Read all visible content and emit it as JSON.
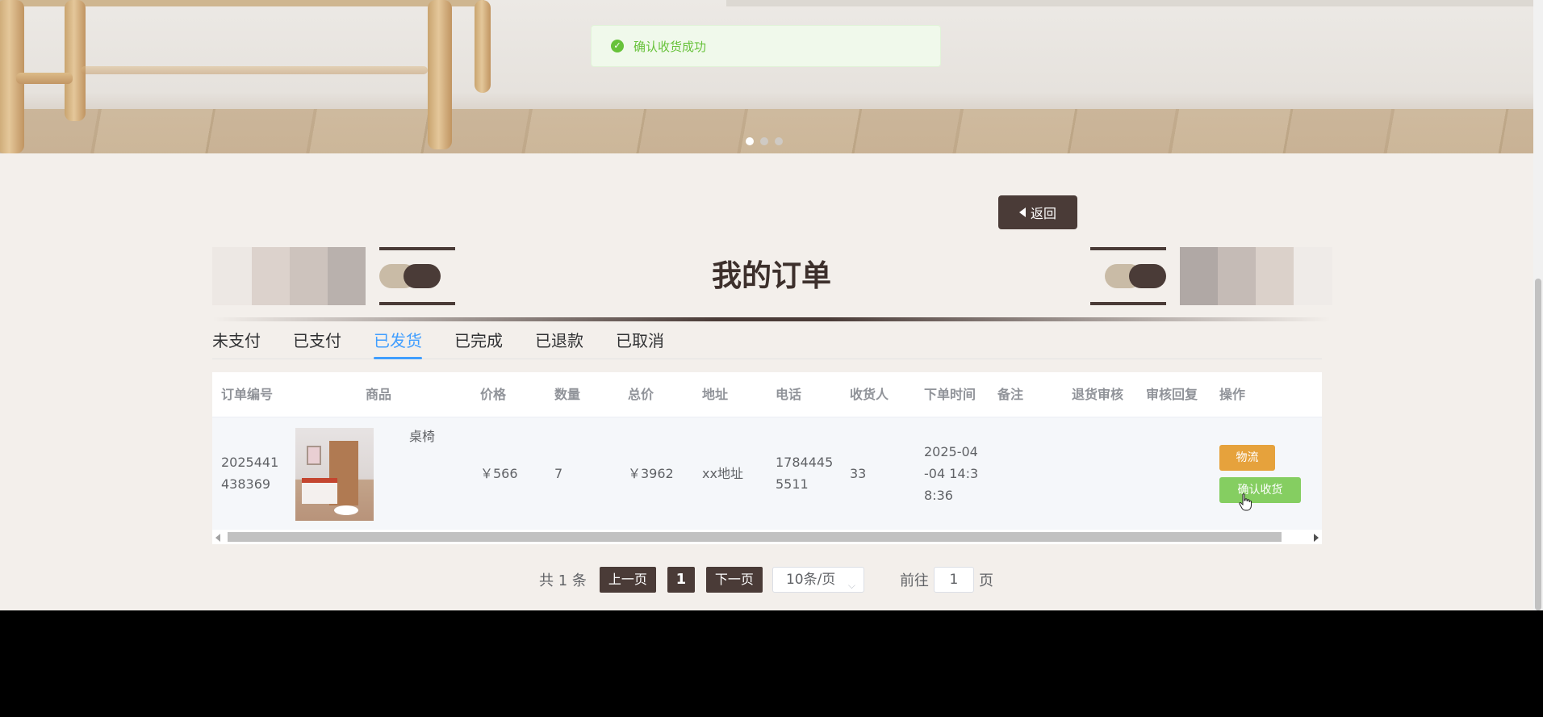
{
  "toast": {
    "message": "确认收货成功"
  },
  "carousel": {
    "dots": 3,
    "active": 0
  },
  "back_label": "返回",
  "page_title": "我的订单",
  "tabs": [
    "未支付",
    "已支付",
    "已发货",
    "已完成",
    "已退款",
    "已取消"
  ],
  "active_tab": 2,
  "table": {
    "headers": [
      "订单编号",
      "商品",
      "价格",
      "数量",
      "总价",
      "地址",
      "电话",
      "收货人",
      "下单时间",
      "备注",
      "退货审核",
      "审核回复",
      "操作"
    ],
    "row": {
      "order_no_line1": "2025441",
      "order_no_line2": "438369",
      "product_name": "桌椅",
      "price": "￥566",
      "qty": "7",
      "total": "￥3962",
      "address": "xx地址",
      "phone_line1": "1784445",
      "phone_line2": "5511",
      "receiver": "33",
      "time_line1": "2025-04",
      "time_line2": "-04 14:3",
      "time_line3": "8:36",
      "remark": "",
      "return_review": "",
      "review_reply": "",
      "btn_logistics": "物流",
      "btn_confirm": "确认收货"
    }
  },
  "pagination": {
    "total_text": "共 1 条",
    "prev": "上一页",
    "current": "1",
    "next": "下一页",
    "page_size": "10条/页",
    "goto_label": "前往",
    "goto_value": "1",
    "page_unit": "页"
  },
  "colors": {
    "accent_dark": "#4a3b37",
    "tab_active": "#409eff",
    "logistics_btn": "#e6a23c",
    "confirm_btn": "#85ce61",
    "toast_text": "#67c23a"
  }
}
